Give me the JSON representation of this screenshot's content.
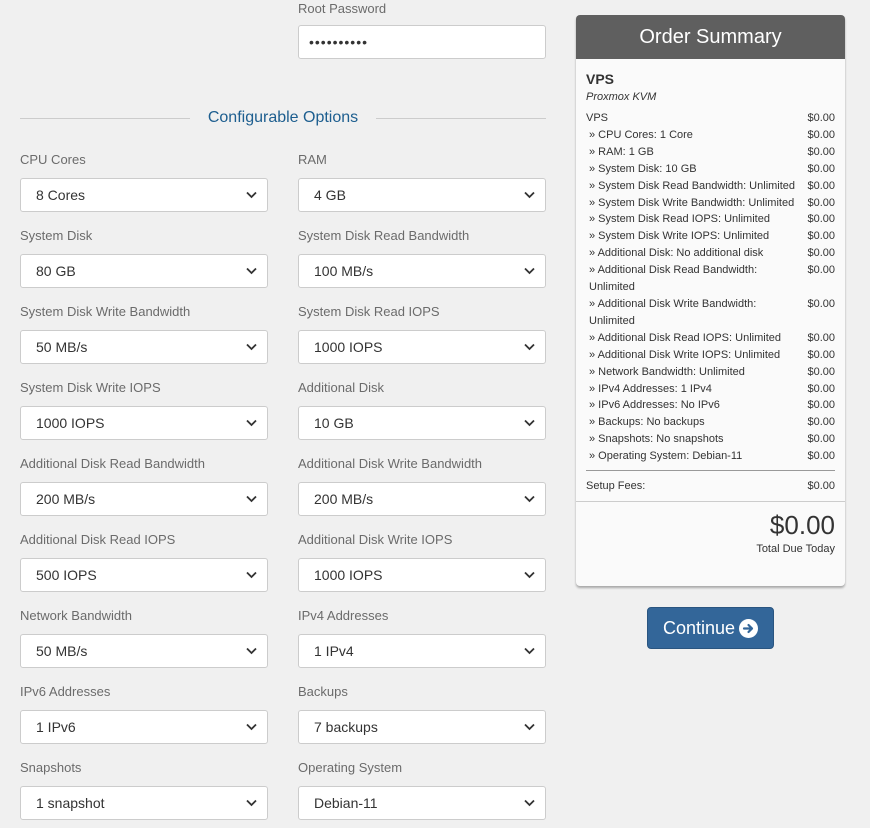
{
  "root_password": {
    "label": "Root Password",
    "value": "••••••••••"
  },
  "configurable_options": {
    "title": "Configurable Options",
    "options": [
      {
        "label": "CPU Cores",
        "value": "8 Cores"
      },
      {
        "label": "RAM",
        "value": "4 GB"
      },
      {
        "label": "System Disk",
        "value": "80 GB"
      },
      {
        "label": "System Disk Read Bandwidth",
        "value": "100 MB/s"
      },
      {
        "label": "System Disk Write Bandwidth",
        "value": "50 MB/s"
      },
      {
        "label": "System Disk Read IOPS",
        "value": "1000 IOPS"
      },
      {
        "label": "System Disk Write IOPS",
        "value": "1000 IOPS"
      },
      {
        "label": "Additional Disk",
        "value": "10 GB"
      },
      {
        "label": "Additional Disk Read Bandwidth",
        "value": "200 MB/s"
      },
      {
        "label": "Additional Disk Write Bandwidth",
        "value": "200 MB/s"
      },
      {
        "label": "Additional Disk Read IOPS",
        "value": "500 IOPS"
      },
      {
        "label": "Additional Disk Write IOPS",
        "value": "1000 IOPS"
      },
      {
        "label": "Network Bandwidth",
        "value": "50 MB/s"
      },
      {
        "label": "IPv4 Addresses",
        "value": "1 IPv4"
      },
      {
        "label": "IPv6 Addresses",
        "value": "1 IPv6"
      },
      {
        "label": "Backups",
        "value": "7 backups"
      },
      {
        "label": "Snapshots",
        "value": "1 snapshot"
      },
      {
        "label": "Operating System",
        "value": "Debian-11"
      }
    ]
  },
  "order_summary": {
    "title": "Order Summary",
    "product_name": "VPS",
    "product_group": "Proxmox KVM",
    "lines": [
      {
        "name": "VPS",
        "price": "$0.00"
      },
      {
        "name": "» CPU Cores: 1 Core",
        "price": "$0.00"
      },
      {
        "name": "» RAM: 1 GB",
        "price": "$0.00"
      },
      {
        "name": "» System Disk: 10 GB",
        "price": "$0.00"
      },
      {
        "name": "» System Disk Read Bandwidth: Unlimited",
        "price": "$0.00"
      },
      {
        "name": "» System Disk Write Bandwidth: Unlimited",
        "price": "$0.00"
      },
      {
        "name": "» System Disk Read IOPS: Unlimited",
        "price": "$0.00"
      },
      {
        "name": "» System Disk Write IOPS: Unlimited",
        "price": "$0.00"
      },
      {
        "name": "» Additional Disk: No additional disk",
        "price": "$0.00"
      },
      {
        "name": "» Additional Disk Read Bandwidth: Unlimited",
        "price": "$0.00"
      },
      {
        "name": "» Additional Disk Write Bandwidth: Unlimited",
        "price": "$0.00"
      },
      {
        "name": "» Additional Disk Read IOPS: Unlimited",
        "price": "$0.00"
      },
      {
        "name": "» Additional Disk Write IOPS: Unlimited",
        "price": "$0.00"
      },
      {
        "name": "» Network Bandwidth: Unlimited",
        "price": "$0.00"
      },
      {
        "name": "» IPv4 Addresses: 1 IPv4",
        "price": "$0.00"
      },
      {
        "name": "» IPv6 Addresses: No IPv6",
        "price": "$0.00"
      },
      {
        "name": "» Backups: No backups",
        "price": "$0.00"
      },
      {
        "name": "» Snapshots: No snapshots",
        "price": "$0.00"
      },
      {
        "name": "» Operating System: Debian-11",
        "price": "$0.00"
      }
    ],
    "setup_fees_label": "Setup Fees:",
    "setup_fees_value": "$0.00",
    "total": "$0.00",
    "total_label": "Total Due Today"
  },
  "continue_button": {
    "label": "Continue",
    "icon": "arrow-circle-right-icon"
  },
  "colors": {
    "accent": "#336699",
    "summary_header": "#5f5f5f",
    "section_title": "#1d5e8f"
  }
}
